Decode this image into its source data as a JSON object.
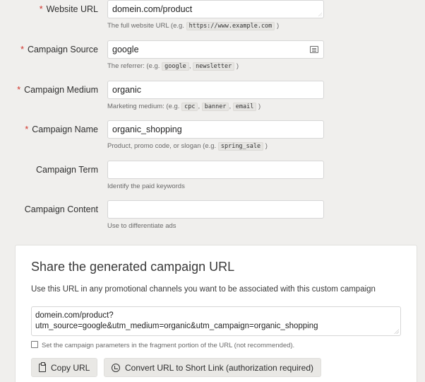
{
  "form": {
    "website_url": {
      "label": "Website URL",
      "required": "*",
      "value": "domein.com/product",
      "hint_prefix": "The full website URL (e.g.",
      "hint_code": "https://www.example.com",
      "hint_suffix": ")"
    },
    "campaign_source": {
      "label": "Campaign Source",
      "required": "*",
      "value": "google",
      "hint_prefix": "The referrer: (e.g.",
      "hint_codes": [
        "google",
        "newsletter"
      ],
      "hint_suffix": ")"
    },
    "campaign_medium": {
      "label": "Campaign Medium",
      "required": "*",
      "value": "organic",
      "hint_prefix": "Marketing medium: (e.g.",
      "hint_codes": [
        "cpc",
        "banner",
        "email"
      ],
      "hint_suffix": ")"
    },
    "campaign_name": {
      "label": "Campaign Name",
      "required": "*",
      "value": "organic_shopping",
      "hint_prefix": "Product, promo code, or slogan (e.g.",
      "hint_code": "spring_sale",
      "hint_suffix": ")"
    },
    "campaign_term": {
      "label": "Campaign Term",
      "value": "",
      "hint": "Identify the paid keywords"
    },
    "campaign_content": {
      "label": "Campaign Content",
      "value": "",
      "hint": "Use to differentiate ads"
    }
  },
  "share": {
    "title": "Share the generated campaign URL",
    "description": "Use this URL in any promotional channels you want to be associated with this custom campaign",
    "url_line1": "domein.com/product?",
    "url_line2": "utm_source=google&utm_medium=organic&utm_campaign=organic_shopping",
    "fragment_checkbox_label": "Set the campaign parameters in the fragment portion of the URL (not recommended).",
    "copy_button": "Copy URL",
    "short_link_button": "Convert URL to Short Link (authorization required)"
  },
  "icons": {
    "source_field": "list-icon",
    "copy": "clipboard-icon",
    "short_link": "link-icon"
  }
}
